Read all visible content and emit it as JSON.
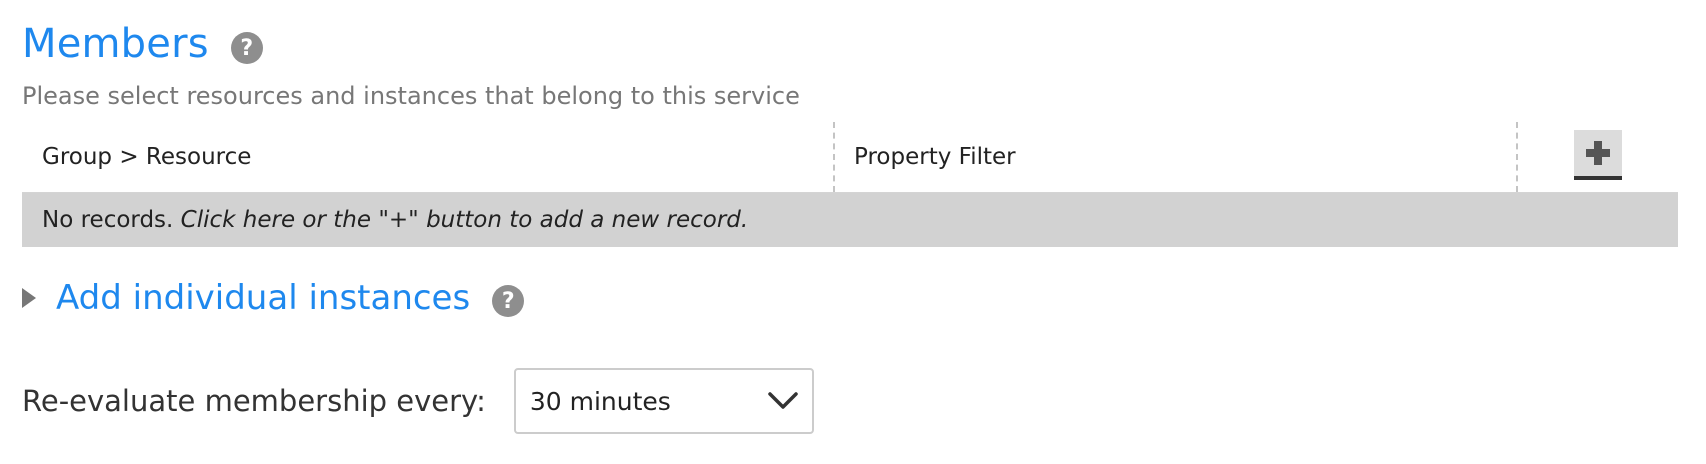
{
  "members": {
    "title": "Members",
    "help_glyph": "?",
    "subtitle": "Please select resources and instances that belong to this service"
  },
  "table": {
    "columns": [
      "Group > Resource",
      "Property Filter"
    ],
    "add_button_icon": "plus-icon",
    "empty_message": {
      "prefix": "No records. ",
      "hint": "Click here or the \"+\" button to add a new record."
    }
  },
  "individual_instances": {
    "link_label": "Add individual instances",
    "help_glyph": "?"
  },
  "reevaluate": {
    "label": "Re-evaluate membership every:",
    "selected_value": "30 minutes"
  },
  "colors": {
    "accent": "#1e88ee",
    "help_icon_bg": "#8e8e8e",
    "empty_row_bg": "#d2d2d2"
  }
}
